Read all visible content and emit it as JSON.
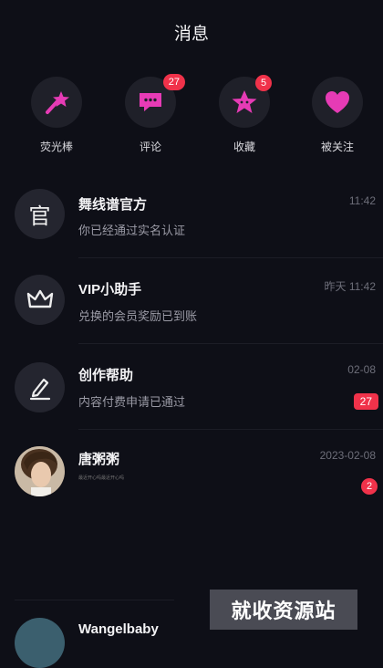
{
  "header": {
    "title": "消息"
  },
  "quick": [
    {
      "label": "荧光棒",
      "icon": "magic-wand-star-icon",
      "badge": ""
    },
    {
      "label": "评论",
      "icon": "comment-bubble-icon",
      "badge": "27"
    },
    {
      "label": "收藏",
      "icon": "star-icon",
      "badge": "5"
    },
    {
      "label": "被关注",
      "icon": "heart-icon",
      "badge": ""
    }
  ],
  "messages": [
    {
      "name": "舞线谱官方",
      "text": "你已经通过实名认证",
      "time": "11:42",
      "icon": "official-text-icon",
      "avatar_text": "官",
      "badge": ""
    },
    {
      "name": "VIP小助手",
      "text": "兑换的会员奖励已到账",
      "time": "昨天 11:42",
      "icon": "crown-icon",
      "badge": ""
    },
    {
      "name": "创作帮助",
      "text": "内容付费申请已通过",
      "time": "02-08",
      "icon": "edit-pen-icon",
      "badge": "27"
    },
    {
      "name": "唐粥粥",
      "text": "最近开心吗最近开心吗",
      "time": "2023-02-08",
      "icon": "user-photo-avatar",
      "badge": "2"
    }
  ],
  "partial_row": {
    "name": "Wangelbaby"
  },
  "watermark": "就收资源站",
  "colors": {
    "accent": "#f0324a",
    "icon_pink": "#e63bb5",
    "background": "#0e0f17"
  }
}
